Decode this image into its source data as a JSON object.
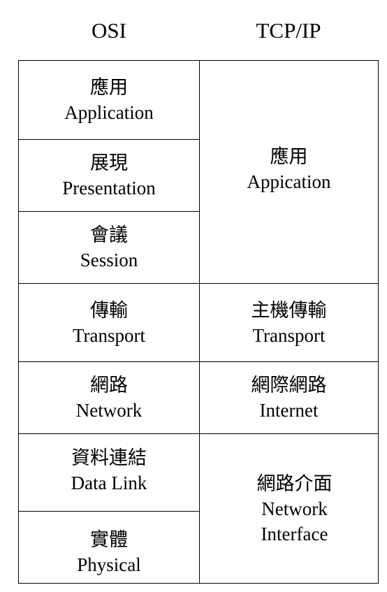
{
  "headers": {
    "osi": "OSI",
    "tcpip": "TCP/IP"
  },
  "osi": [
    {
      "zh": "應用",
      "en": "Application"
    },
    {
      "zh": "展現",
      "en": "Presentation"
    },
    {
      "zh": "會議",
      "en": "Session"
    },
    {
      "zh": "傳輸",
      "en": "Transport"
    },
    {
      "zh": "網路",
      "en": "Network"
    },
    {
      "zh": "資料連結",
      "en": "Data Link"
    },
    {
      "zh": "實體",
      "en": "Physical"
    }
  ],
  "tcpip": [
    {
      "zh": "應用",
      "en": "Appication"
    },
    {
      "zh": "主機傳輸",
      "en": "Transport"
    },
    {
      "zh": "網際網路",
      "en": "Internet"
    },
    {
      "zh": "網路介面",
      "en": "Network",
      "en2": "Interface"
    }
  ]
}
